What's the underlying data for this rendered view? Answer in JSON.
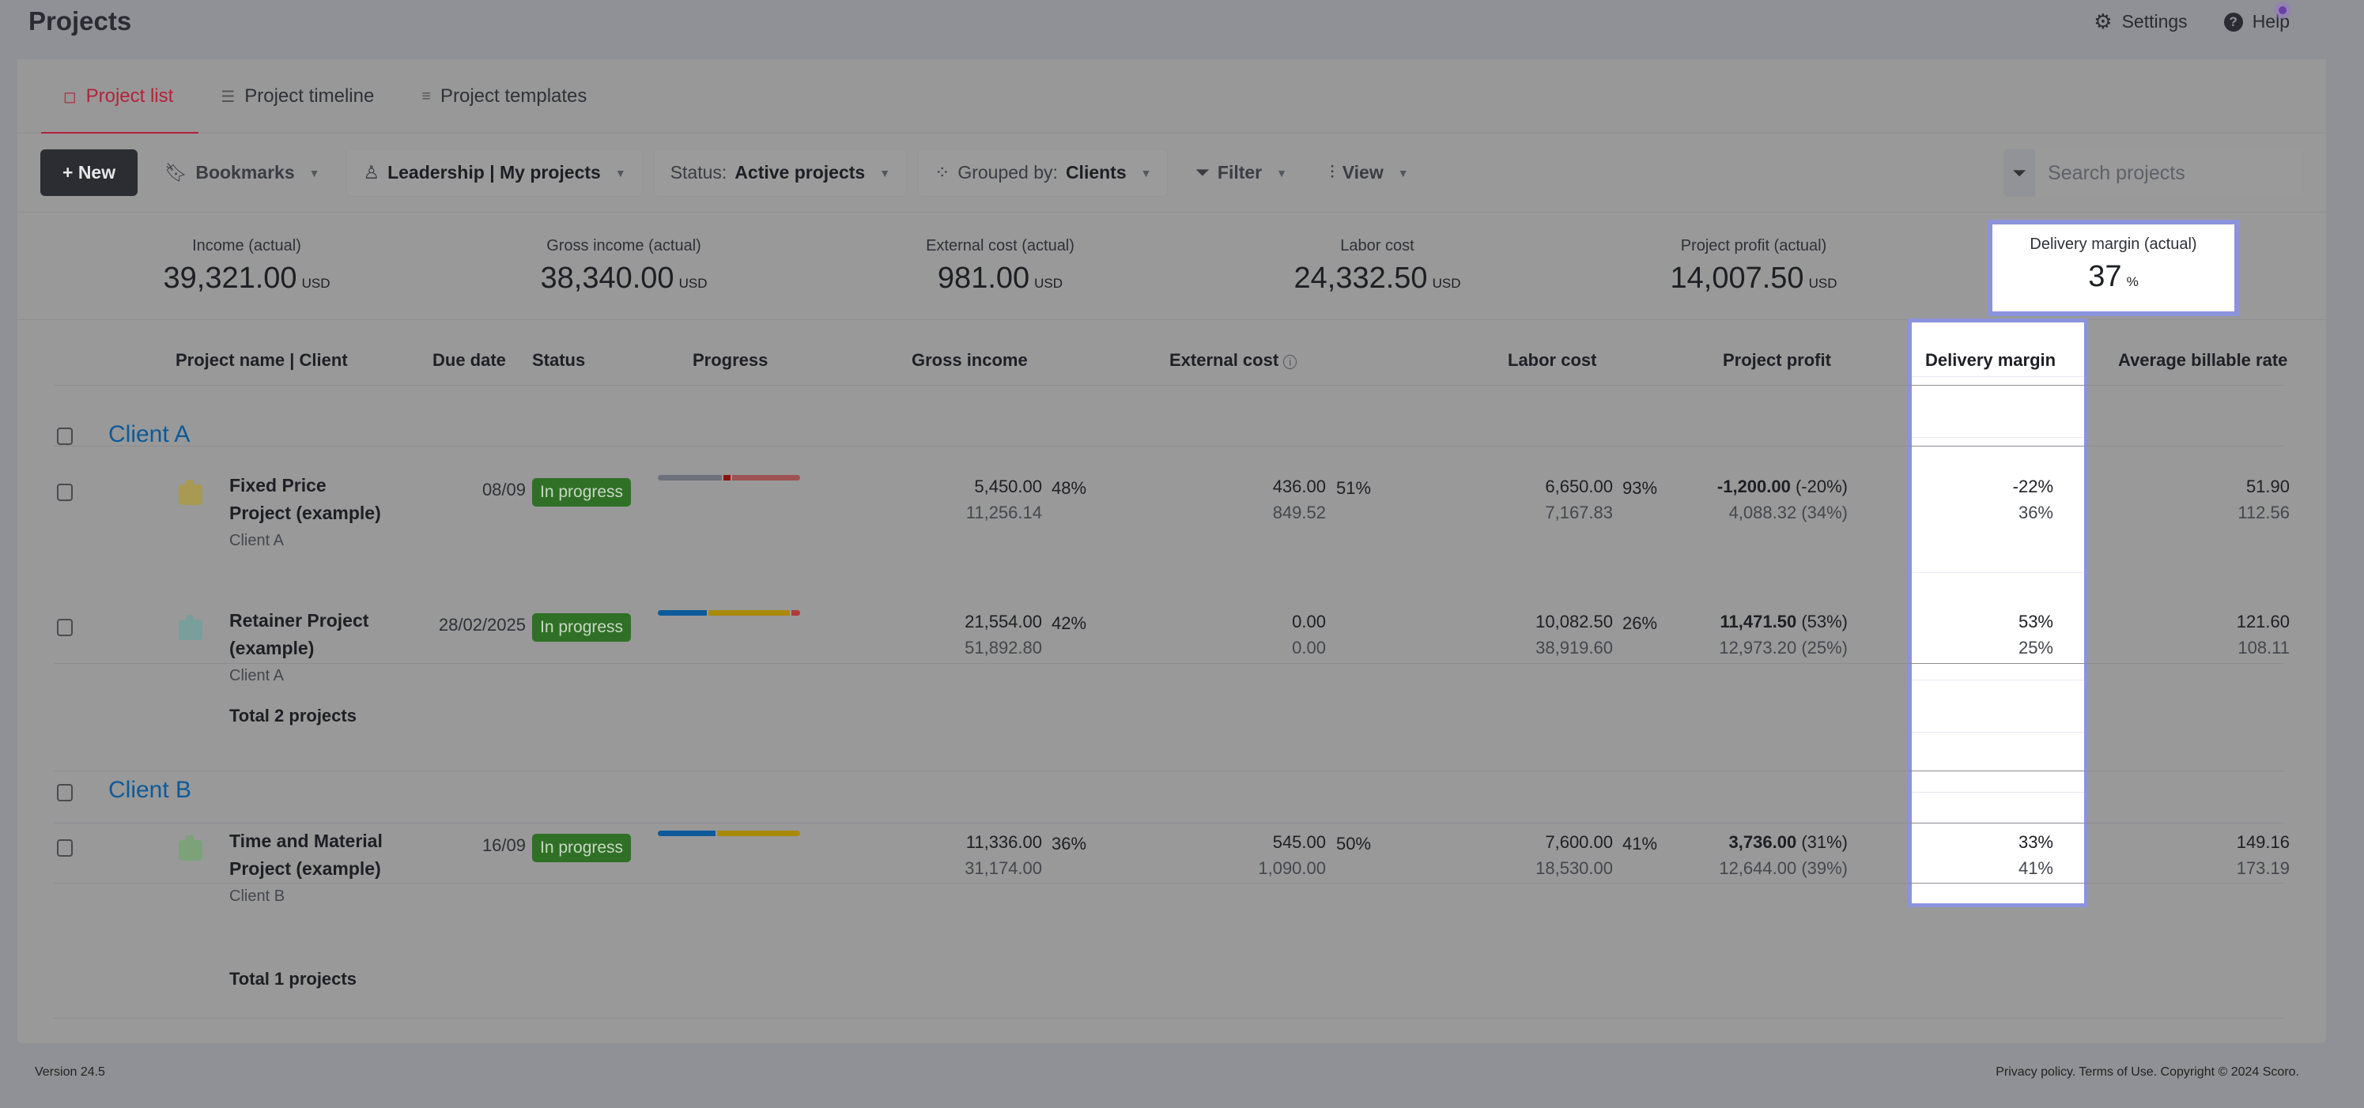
{
  "header": {
    "title": "Projects",
    "settings_label": "Settings",
    "help_label": "Help"
  },
  "tabs": [
    {
      "label": "Project list",
      "active": true
    },
    {
      "label": "Project timeline",
      "active": false
    },
    {
      "label": "Project templates",
      "active": false
    }
  ],
  "toolbar": {
    "new_label": "+ New",
    "bookmarks_label": "Bookmarks",
    "scope_label": "Leadership | My projects",
    "status_prefix": "Status:",
    "status_value": "Active projects",
    "group_prefix": "Grouped by:",
    "group_value": "Clients",
    "filter_label": "Filter",
    "view_label": "View",
    "search_placeholder": "Search projects"
  },
  "summary": [
    {
      "label": "Income (actual)",
      "value": "39,321.00",
      "unit": "USD"
    },
    {
      "label": "Gross income (actual)",
      "value": "38,340.00",
      "unit": "USD"
    },
    {
      "label": "External cost (actual)",
      "value": "981.00",
      "unit": "USD"
    },
    {
      "label": "Labor cost",
      "value": "24,332.50",
      "unit": "USD"
    },
    {
      "label": "Project profit (actual)",
      "value": "14,007.50",
      "unit": "USD"
    },
    {
      "label": "Delivery margin (actual)",
      "value": "37",
      "unit": "%"
    }
  ],
  "columns": {
    "name": "Project name | Client",
    "due": "Due date",
    "status": "Status",
    "progress": "Progress",
    "gross": "Gross income",
    "external": "External cost",
    "labor": "Labor cost",
    "profit": "Project profit",
    "margin": "Delivery margin",
    "rate": "Average billable rate"
  },
  "groups": [
    {
      "client": "Client A",
      "total_label": "Total 2 projects",
      "projects": [
        {
          "name": "Fixed Price Project (example)",
          "client": "Client A",
          "due": "08/09",
          "status": "In progress",
          "icon_color": "#a89a52",
          "progress_segments": [
            {
              "share": 0.46,
              "color": "#6b727c"
            },
            {
              "share": 0.05,
              "color": "#8e1212"
            },
            {
              "share": 0.49,
              "color": "#9e5252"
            }
          ],
          "gross": "5,450.00",
          "gross_planned": "11,256.14",
          "gross_pct": "48%",
          "external": "436.00",
          "external_planned": "849.52",
          "external_pct": "51%",
          "labor": "6,650.00",
          "labor_planned": "7,167.83",
          "labor_pct": "93%",
          "profit": "-1,200.00",
          "profit_pct": "(-20%)",
          "profit_planned": "4,088.32 (34%)",
          "margin": "-22%",
          "margin_planned": "36%",
          "rate": "51.90",
          "rate_planned": "112.56"
        },
        {
          "name": "Retainer Project (example)",
          "client": "Client A",
          "due": "28/02/2025",
          "status": "In progress",
          "icon_color": "#7a9e9b",
          "progress_segments": [
            {
              "share": 0.35,
              "color": "#0c5a9a"
            },
            {
              "share": 0.59,
              "color": "#a88a0a"
            },
            {
              "share": 0.06,
              "color": "#b03a3a"
            }
          ],
          "gross": "21,554.00",
          "gross_planned": "51,892.80",
          "gross_pct": "42%",
          "external": "0.00",
          "external_planned": "0.00",
          "external_pct": "",
          "labor": "10,082.50",
          "labor_planned": "38,919.60",
          "labor_pct": "26%",
          "profit": "11,471.50",
          "profit_pct": "(53%)",
          "profit_planned": "12,973.20 (25%)",
          "margin": "53%",
          "margin_planned": "25%",
          "rate": "121.60",
          "rate_planned": "108.11"
        }
      ]
    },
    {
      "client": "Client B",
      "total_label": "Total 1 projects",
      "projects": [
        {
          "name": "Time and Material Project (example)",
          "client": "Client B",
          "due": "16/09",
          "status": "In progress",
          "icon_color": "#7da27a",
          "progress_segments": [
            {
              "share": 0.41,
              "color": "#0c5a9a"
            },
            {
              "share": 0.59,
              "color": "#a88a0a"
            }
          ],
          "gross": "11,336.00",
          "gross_planned": "31,174.00",
          "gross_pct": "36%",
          "external": "545.00",
          "external_planned": "1,090.00",
          "external_pct": "50%",
          "labor": "7,600.00",
          "labor_planned": "18,530.00",
          "labor_pct": "41%",
          "profit": "3,736.00",
          "profit_pct": "(31%)",
          "profit_planned": "12,644.00 (39%)",
          "margin": "33%",
          "margin_planned": "41%",
          "rate": "149.16",
          "rate_planned": "173.19"
        }
      ]
    }
  ],
  "footer": {
    "version": "Version 24.5",
    "legal": "Privacy policy. Terms of Use. Copyright © 2024 Scoro."
  }
}
